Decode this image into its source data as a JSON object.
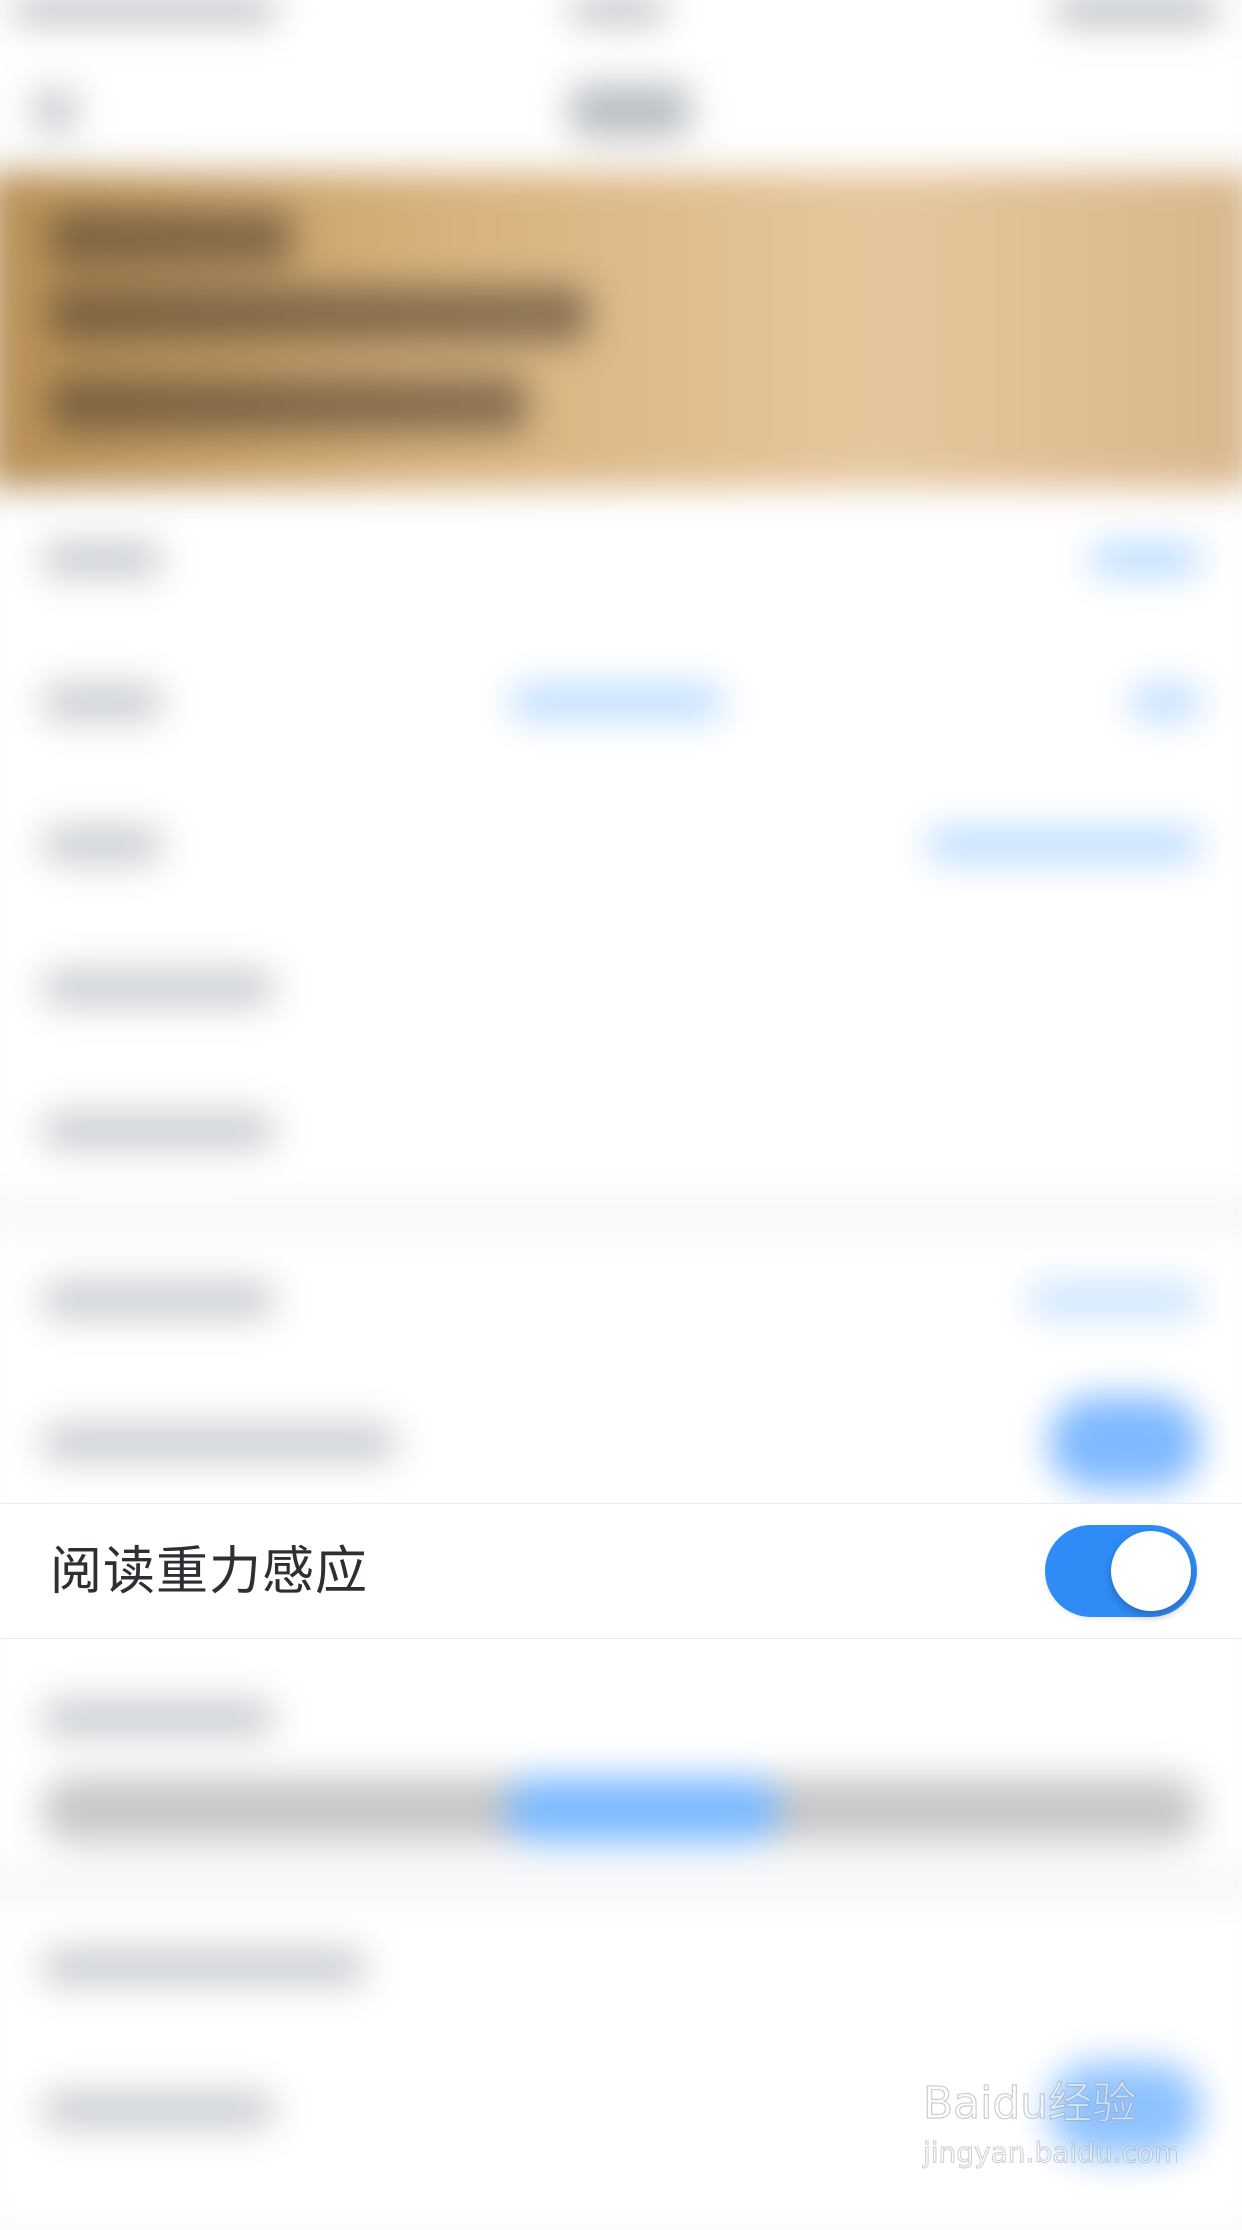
{
  "settings": {
    "focused_row": {
      "label": "阅读重力感应",
      "toggle_on": true
    }
  },
  "watermark": {
    "brand": "Baidu经验",
    "url": "jingyan.baidu.com"
  },
  "colors": {
    "toggle_on": "#2f8cf7",
    "banner_start": "#b88e55",
    "banner_end": "#d8b68a"
  }
}
